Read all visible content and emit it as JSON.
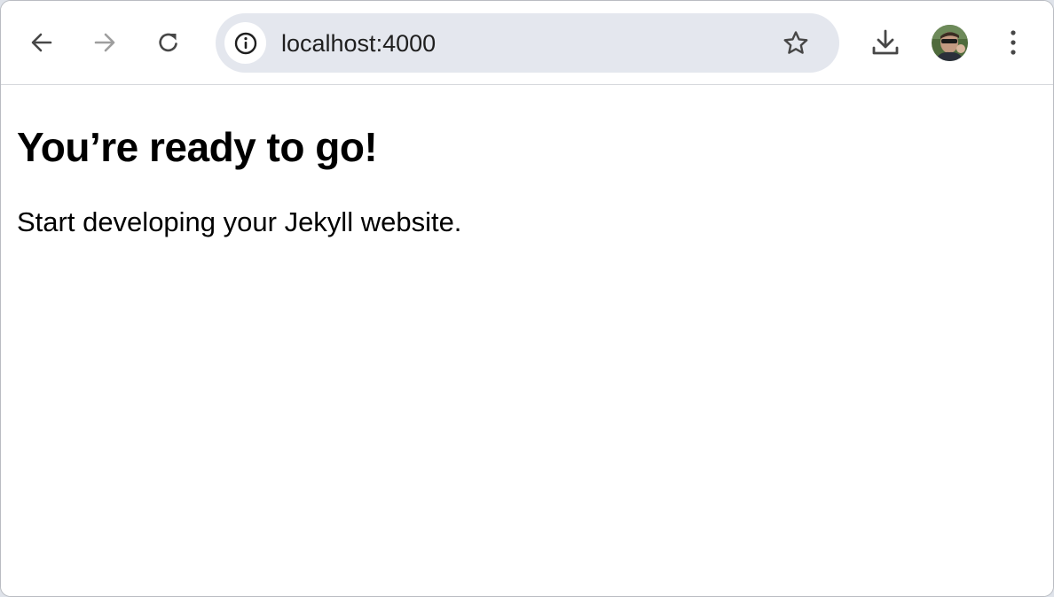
{
  "browser": {
    "url": "localhost:4000",
    "icons": {
      "back": "arrow-left-icon",
      "forward": "arrow-right-icon",
      "reload": "reload-icon",
      "site_info": "info-icon",
      "bookmark": "star-icon",
      "download": "download-icon",
      "menu": "kebab-menu-icon"
    },
    "forward_enabled": false,
    "colors": {
      "omnibox_bg": "#e4e7ee",
      "icon": "#474747",
      "icon_disabled": "#9e9e9e"
    }
  },
  "page": {
    "heading": "You’re ready to go!",
    "body": "Start developing your Jekyll website."
  }
}
